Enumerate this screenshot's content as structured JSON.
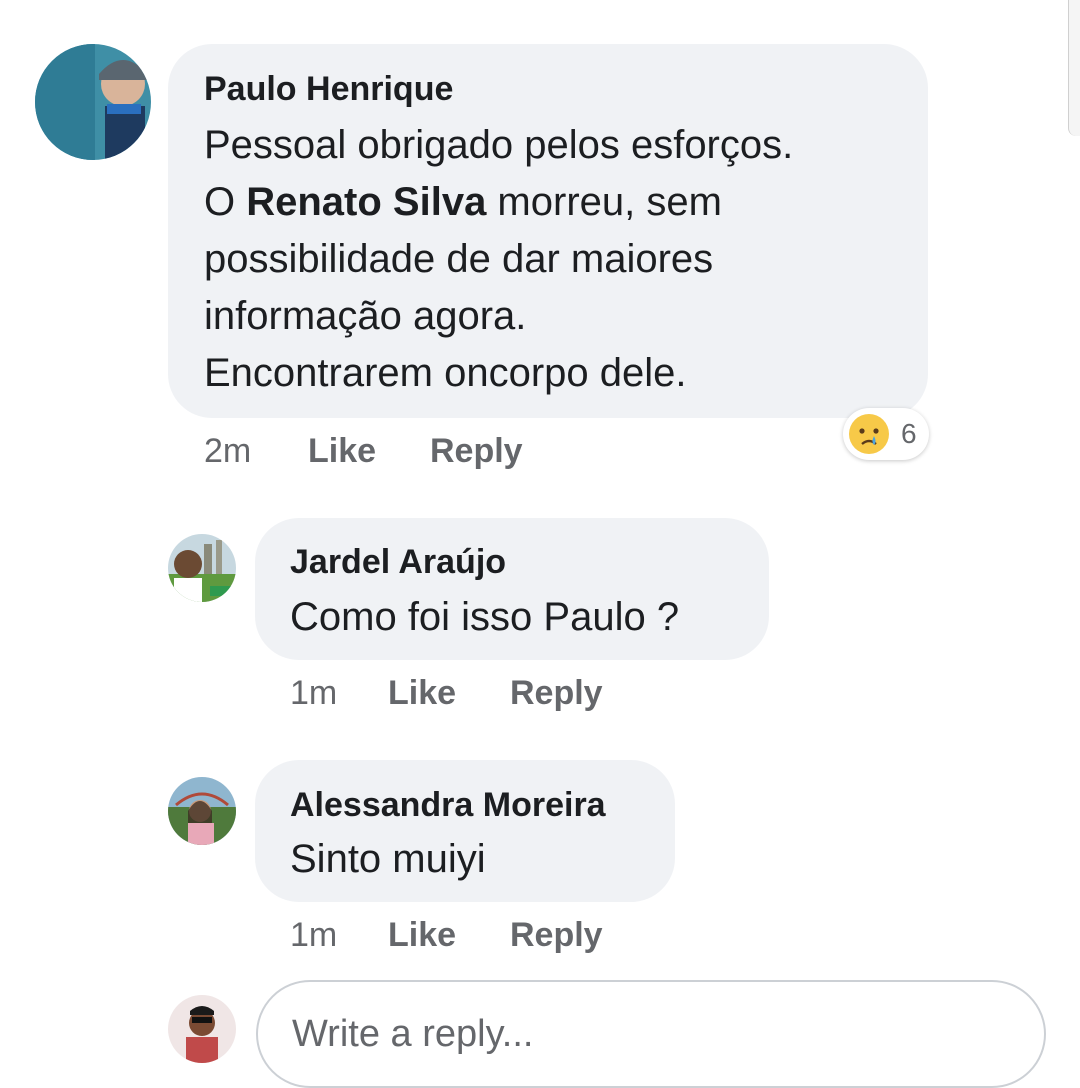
{
  "comments": [
    {
      "author": "Paulo Henrique",
      "lines": {
        "l1": "Pessoal obrigado pelos esforços.",
        "l2_prefix": "O ",
        "l2_mention": "Renato Silva",
        "l2_suffix": " morreu, sem",
        "l3": "possibilidade de dar maiores",
        "l4": "informação agora.",
        "l5": "Encontrarem oncorpo dele."
      },
      "time": "2m",
      "like_label": "Like",
      "reply_label": "Reply",
      "reaction": {
        "icon": "sad-emoji-icon",
        "count": "6"
      }
    },
    {
      "author": "Jardel Araújo",
      "text": "Como foi isso Paulo ?",
      "time": "1m",
      "like_label": "Like",
      "reply_label": "Reply"
    },
    {
      "author": "Alessandra Moreira",
      "text": "Sinto muiyi",
      "time": "1m",
      "like_label": "Like",
      "reply_label": "Reply"
    }
  ],
  "reply_input": {
    "placeholder": "Write a reply..."
  },
  "colors": {
    "bubble": "#f0f2f5",
    "meta_text": "#65676b",
    "primary_text": "#1c1e21",
    "reaction_yellow": "#f7c948"
  }
}
